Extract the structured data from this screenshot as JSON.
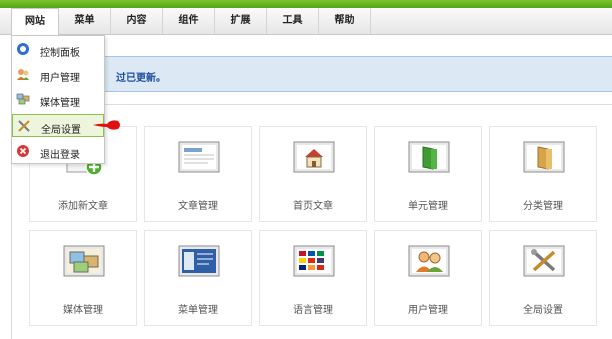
{
  "menubar": {
    "items": [
      "网站",
      "菜单",
      "内容",
      "组件",
      "扩展",
      "工具",
      "帮助"
    ],
    "active": "网站"
  },
  "dropdown": {
    "items": [
      {
        "label": "控制面板",
        "icon": "control-panel-icon"
      },
      {
        "label": "用户管理",
        "icon": "users-icon"
      },
      {
        "label": "媒体管理",
        "icon": "media-icon"
      },
      {
        "label": "全局设置",
        "icon": "settings-tools-icon",
        "highlighted": true
      },
      {
        "label": "退出登录",
        "icon": "logout-icon"
      }
    ]
  },
  "notice": {
    "text": "过已更新。"
  },
  "tiles": [
    {
      "label": "添加新文章",
      "icon": "add-article-icon"
    },
    {
      "label": "文章管理",
      "icon": "article-manager-icon"
    },
    {
      "label": "首页文章",
      "icon": "frontpage-icon"
    },
    {
      "label": "单元管理",
      "icon": "section-icon"
    },
    {
      "label": "分类管理",
      "icon": "category-icon"
    },
    {
      "label": "媒体管理",
      "icon": "media-manager-icon"
    },
    {
      "label": "菜单管理",
      "icon": "menu-manager-icon"
    },
    {
      "label": "语言管理",
      "icon": "language-icon"
    },
    {
      "label": "用户管理",
      "icon": "user-manager-icon"
    },
    {
      "label": "全局设置",
      "icon": "global-config-icon"
    }
  ],
  "colors": {
    "accent_green": "#6ab823",
    "notice_blue": "#1b4f9c",
    "highlight_border": "#8fbf4b",
    "pointer_red": "#e01010"
  }
}
